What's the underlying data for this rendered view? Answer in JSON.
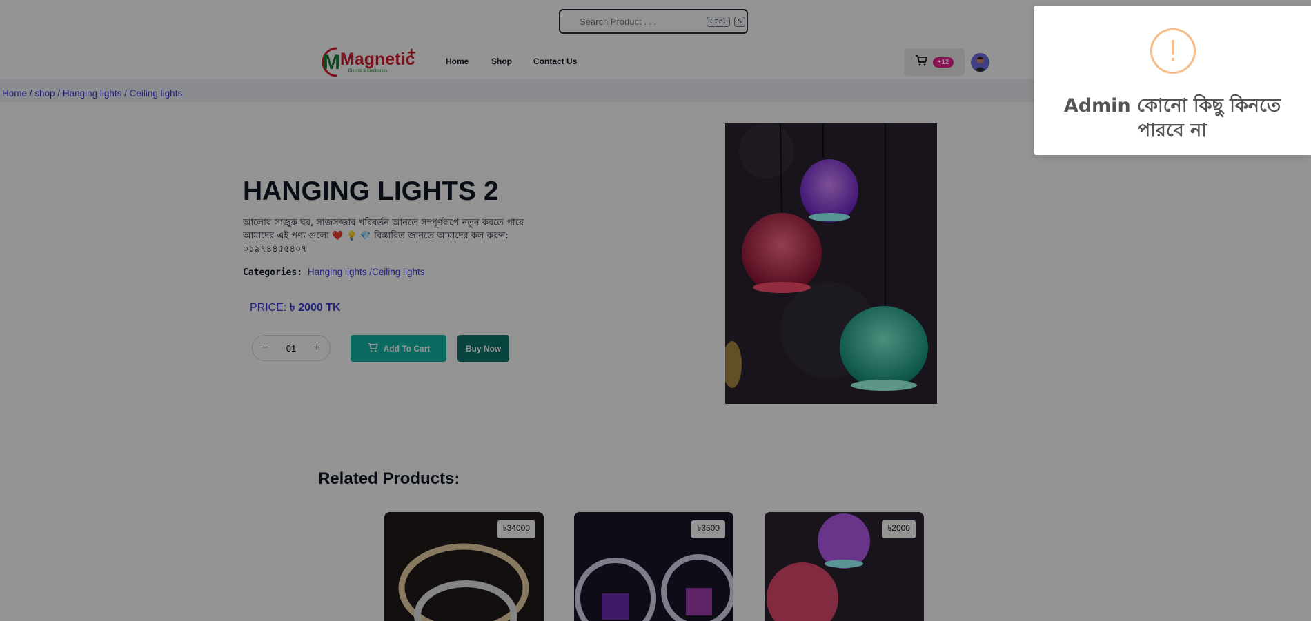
{
  "search": {
    "placeholder": "Search Product . . .",
    "shortcut_key1": "Ctrl",
    "shortcut_key2": "S"
  },
  "brand": {
    "logo_text": "Magnetic",
    "logo_plus": "+",
    "logo_subtitle": "Electric & Electronics"
  },
  "nav": {
    "items": [
      {
        "label": "Home"
      },
      {
        "label": "Shop"
      },
      {
        "label": "Contact Us"
      }
    ]
  },
  "cart": {
    "badge": "+12"
  },
  "breadcrumb": {
    "items": [
      "Home /",
      "shop /",
      "Hanging lights /",
      "Ceiling lights"
    ]
  },
  "product": {
    "title": "HANGING LIGHTS 2",
    "description": "আলোয় সাজুক ঘর, সাজসজ্জার পরিবর্তন আনতে সম্পূর্ণরূপে নতুন করতে পারে আমাদের এই পণ্য গুলো ❤️ 💡 💎 বিস্তারিত জানতে আমাদের কল করুন: ০১৯৭৪৪৫৫৪০৭",
    "categories_label": "Categories:",
    "categories": "Hanging lights /Ceiling lights",
    "price_label": "PRICE:",
    "price_value": "৳ 2000 TK",
    "quantity": "01",
    "add_to_cart": "Add To Cart",
    "buy_now": "Buy Now"
  },
  "related": {
    "title": "Related Products:",
    "items": [
      {
        "price": "৳34000"
      },
      {
        "price": "৳3500"
      },
      {
        "price": "৳2000"
      }
    ]
  },
  "toast": {
    "icon": "!",
    "message": "Admin কোনো কিছু কিনতে পারবে না"
  },
  "colors": {
    "accent": "#14b8a6",
    "buy_now": "#0f766e",
    "link": "#3b3bd9",
    "badge": "#e91e8c",
    "warn": "#f8bb86"
  }
}
